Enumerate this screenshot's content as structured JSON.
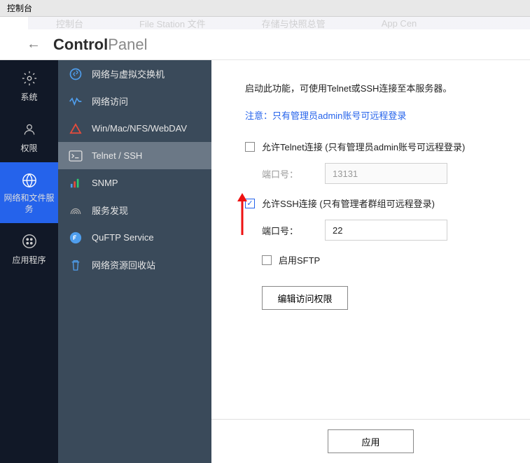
{
  "topbar": {
    "title": "控制台"
  },
  "menubar": {
    "items": [
      "控制台",
      "File Station 文件",
      "存储与快照总管",
      "App Cen"
    ]
  },
  "header": {
    "bold": "Control",
    "thin": "Panel"
  },
  "sidebar1": {
    "items": [
      {
        "label": "系统"
      },
      {
        "label": "权限"
      },
      {
        "label": "网络和文件服务"
      },
      {
        "label": "应用程序"
      }
    ]
  },
  "sidebar2": {
    "items": [
      {
        "label": "网络与虚拟交换机"
      },
      {
        "label": "网络访问"
      },
      {
        "label": "Win/Mac/NFS/WebDAV"
      },
      {
        "label": "Telnet / SSH"
      },
      {
        "label": "SNMP"
      },
      {
        "label": "服务发现"
      },
      {
        "label": "QuFTP Service"
      },
      {
        "label": "网络资源回收站"
      }
    ]
  },
  "content": {
    "description": "启动此功能，可使用Telnet或SSH连接至本服务器。",
    "warning": "注意：只有管理员admin账号可远程登录",
    "telnet": {
      "label": "允许Telnet连接 (只有管理员admin账号可远程登录)",
      "port_label": "端口号：",
      "port_value": "13131"
    },
    "ssh": {
      "label": "允许SSH连接 (只有管理者群组可远程登录)",
      "port_label": "端口号：",
      "port_value": "22",
      "sftp_label": "启用SFTP"
    },
    "edit_button": "编辑访问权限",
    "apply_button": "应用"
  }
}
